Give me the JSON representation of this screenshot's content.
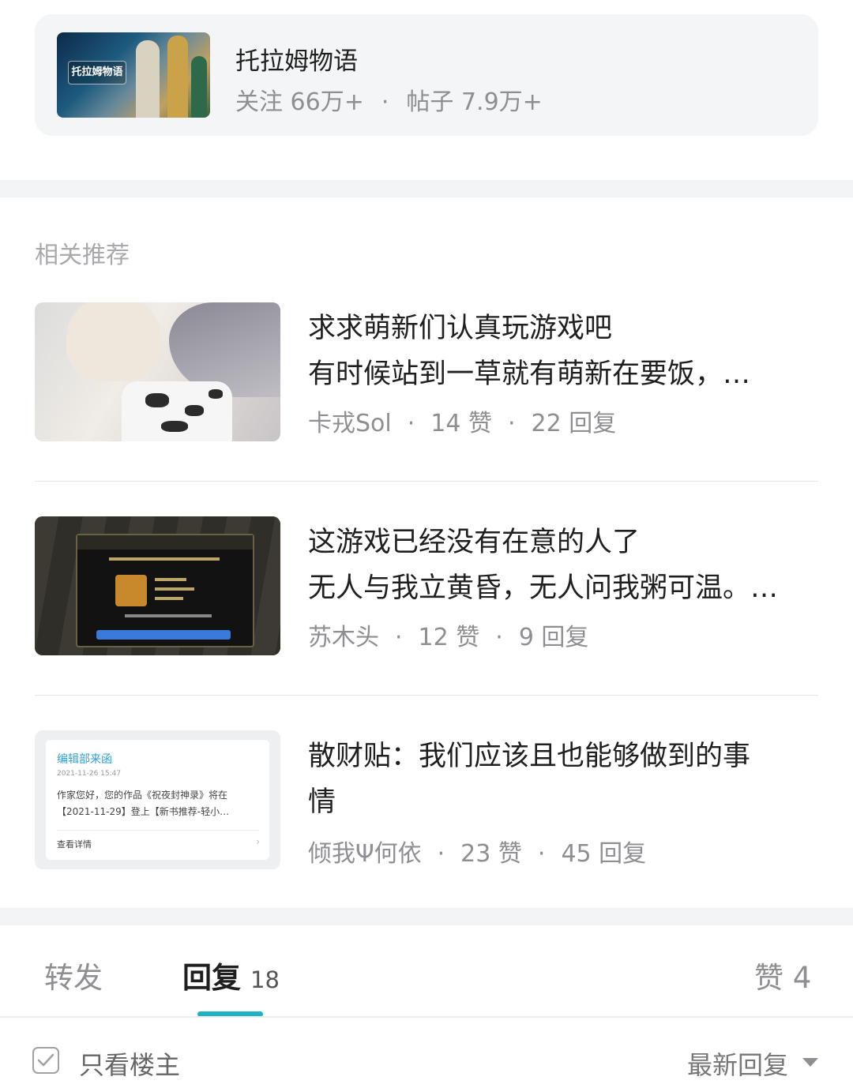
{
  "forum": {
    "name": "托拉姆物语",
    "thumb_logo": "托拉姆物语",
    "followers_label": "关注 66万+",
    "posts_label": "帖子 7.9万+",
    "separator": "·"
  },
  "related": {
    "title": "相关推荐",
    "items": [
      {
        "title_line1": "求求萌新们认真玩游戏吧",
        "title_line2": "有时候站到一草就有萌新在要饭，…",
        "author": "卡戎Sol",
        "likes": "14 赞",
        "replies": "22 回复"
      },
      {
        "title_line1": "这游戏已经没有在意的人了",
        "title_line2": "无人与我立黄昏，无人问我粥可温。…",
        "author": "苏木头",
        "likes": "12 赞",
        "replies": "9 回复"
      },
      {
        "title_line1": "散财贴：我们应该且也能够做到的事",
        "title_line2": "情",
        "author": "倾我Ψ何依",
        "likes": "23 赞",
        "replies": "45 回复",
        "thumb": {
          "heading": "编辑部来函",
          "date": "2021-11-26 15:47",
          "body": "作家您好，您的作品《祝夜封神录》将在【2021-11-29】登上【新书推荐-轻小…",
          "link": "查看详情",
          "chevron": "›"
        }
      }
    ]
  },
  "tabs": {
    "forward": "转发",
    "reply": "回复",
    "reply_count": "18",
    "like": "赞 4"
  },
  "filter": {
    "only_op": "只看楼主",
    "sort": "最新回复"
  },
  "colors": {
    "accent": "#1fb2c4",
    "secondary_text": "#8e8e93"
  }
}
